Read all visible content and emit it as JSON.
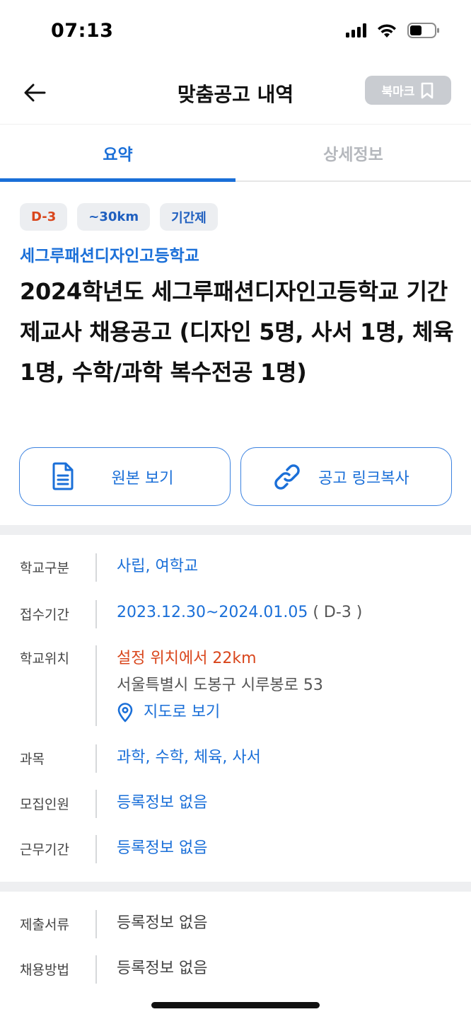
{
  "status_bar": {
    "time": "07:13"
  },
  "header": {
    "title": "맞춤공고 내역",
    "bookmark_label": "북마크"
  },
  "tabs": [
    {
      "label": "요약",
      "active": true
    },
    {
      "label": "상세정보",
      "active": false
    }
  ],
  "chips": [
    "D-3",
    "~30km",
    "기간제"
  ],
  "school_name": "세그루패션디자인고등학교",
  "job_title": "2024학년도 세그루패션디자인고등학교 기간제교사 채용공고 (디자인 5명, 사서 1명, 체육 1명, 수학/과학 복수전공 1명)",
  "actions": {
    "view_original": "원본 보기",
    "copy_link": "공고 링크복사"
  },
  "info": {
    "school_type_label": "학교구분",
    "school_type_value": "사립, 여학교",
    "period_label": "접수기간",
    "period_value": "2023.12.30~2024.01.05",
    "period_dday": "( D-3 )",
    "location_label": "학교위치",
    "location_distance": "설정 위치에서 22km",
    "location_address": "서울특별시 도봉구 시루봉로 53",
    "map_link": "지도로 보기",
    "subject_label": "과목",
    "subject_value": "과학, 수학, 체육, 사서",
    "recruit_label": "모집인원",
    "recruit_value": "등록정보 없음",
    "work_period_label": "근무기간",
    "work_period_value": "등록정보 없음"
  },
  "info2": {
    "documents_label": "제출서류",
    "documents_value": "등록정보 없음",
    "method_label": "채용방법",
    "method_value": "등록정보 없음"
  },
  "colors": {
    "accent": "#1a6fd8",
    "dday": "#d9461c",
    "bookmark_bg": "#c9ccd1"
  }
}
